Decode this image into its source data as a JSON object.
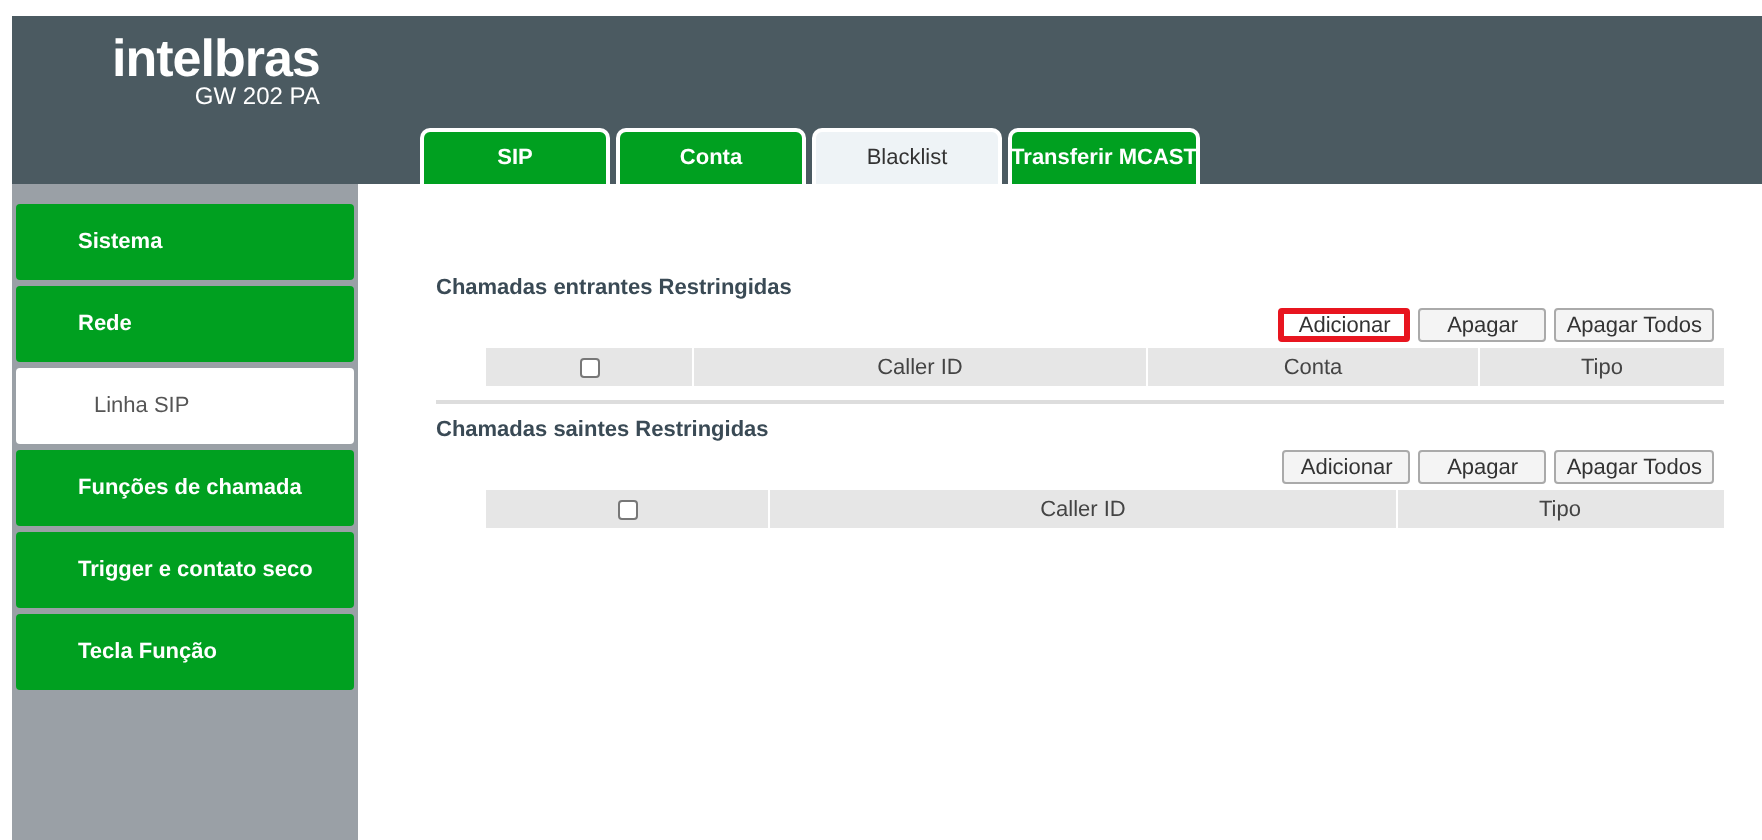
{
  "header": {
    "logo": "intelbras",
    "model": "GW 202 PA"
  },
  "tabs": [
    {
      "label": "SIP",
      "selected": false
    },
    {
      "label": "Conta",
      "selected": false
    },
    {
      "label": "Blacklist",
      "selected": true
    },
    {
      "label": "Transferir MCAST",
      "selected": false
    }
  ],
  "sidebar": {
    "items": [
      {
        "label": "Sistema",
        "selected": false
      },
      {
        "label": "Rede",
        "selected": false
      },
      {
        "label": "Linha SIP",
        "selected": true
      },
      {
        "label": "Funções de chamada",
        "selected": false
      },
      {
        "label": "Trigger e contato seco",
        "selected": false
      },
      {
        "label": "Tecla Função",
        "selected": false
      }
    ]
  },
  "sections": [
    {
      "title": "Chamadas entrantes Restringidas",
      "buttons": [
        {
          "label": "Adicionar",
          "highlighted": true
        },
        {
          "label": "Apagar",
          "highlighted": false
        },
        {
          "label": "Apagar Todos",
          "highlighted": false
        }
      ],
      "select_all_checked": false,
      "columns": [
        {
          "label": "Caller ID"
        },
        {
          "label": "Conta"
        },
        {
          "label": "Tipo"
        }
      ]
    },
    {
      "title": "Chamadas saintes Restringidas",
      "buttons": [
        {
          "label": "Adicionar",
          "highlighted": false
        },
        {
          "label": "Apagar",
          "highlighted": false
        },
        {
          "label": "Apagar Todos",
          "highlighted": false
        }
      ],
      "select_all_checked": false,
      "columns": [
        {
          "label": "Caller ID"
        },
        {
          "label": "Tipo"
        }
      ]
    }
  ]
}
